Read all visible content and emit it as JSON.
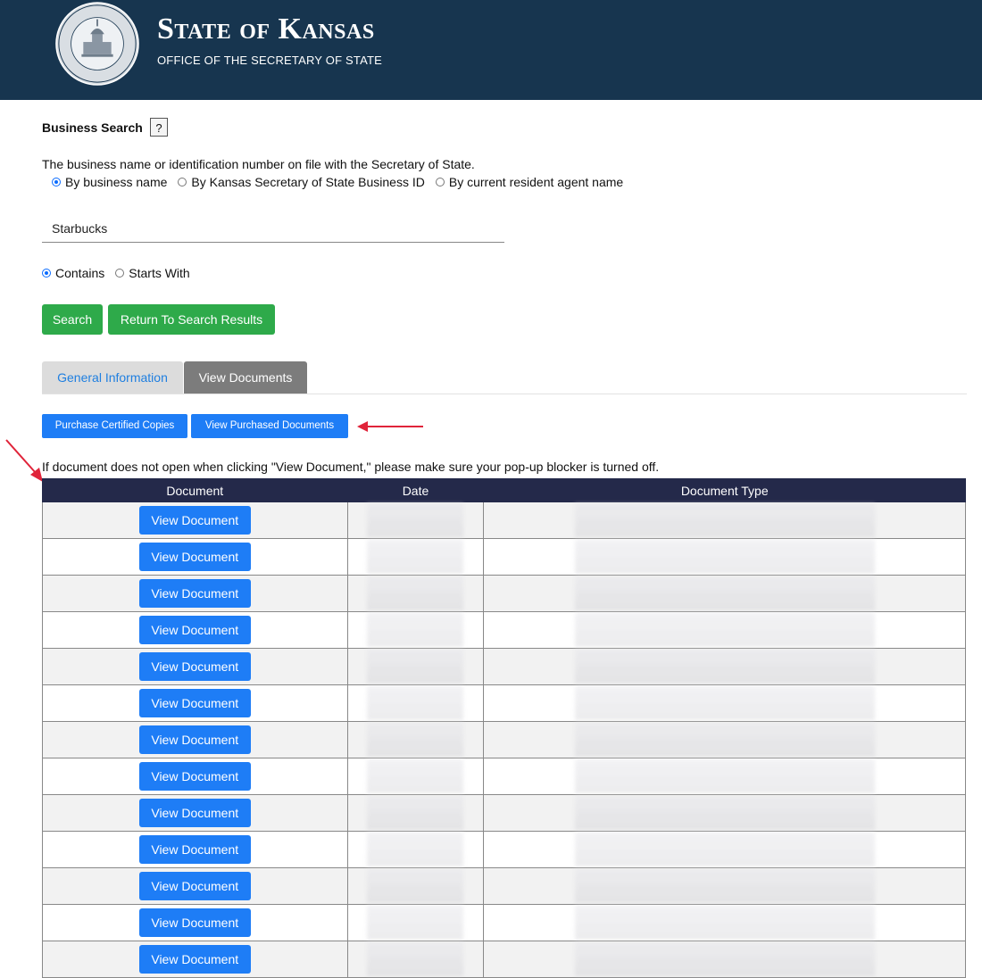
{
  "header": {
    "title": "State of Kansas",
    "subtitle": "OFFICE OF THE SECRETARY OF STATE",
    "seal_text_top": "SECRETARY OF STATE",
    "seal_text_bottom": "STATE OF KANSAS"
  },
  "search": {
    "label": "Business Search",
    "help": "?",
    "description": "The business name or identification number on file with the Secretary of State.",
    "mode_options": [
      {
        "label": "By business name",
        "selected": true
      },
      {
        "label": "By Kansas Secretary of State Business ID",
        "selected": false
      },
      {
        "label": "By current resident agent name",
        "selected": false
      }
    ],
    "query": "Starbucks",
    "match_options": [
      {
        "label": "Contains",
        "selected": true
      },
      {
        "label": "Starts With",
        "selected": false
      }
    ],
    "search_button": "Search",
    "return_button": "Return To Search Results"
  },
  "tabs": {
    "general": "General Information",
    "documents": "View Documents"
  },
  "actions": {
    "purchase": "Purchase Certified Copies",
    "view_purchased": "View Purchased Documents"
  },
  "notice": "If document does not open when clicking \"View Document,\" please make sure your pop-up blocker is turned off.",
  "table": {
    "headers": [
      "Document",
      "Date",
      "Document Type"
    ],
    "button_label": "View Document",
    "rows": [
      {
        "date": "",
        "type": ""
      },
      {
        "date": "",
        "type": ""
      },
      {
        "date": "",
        "type": ""
      },
      {
        "date": "",
        "type": ""
      },
      {
        "date": "",
        "type": ""
      },
      {
        "date": "",
        "type": ""
      },
      {
        "date": "",
        "type": ""
      },
      {
        "date": "",
        "type": ""
      },
      {
        "date": "",
        "type": ""
      },
      {
        "date": "",
        "type": ""
      },
      {
        "date": "",
        "type": ""
      },
      {
        "date": "",
        "type": ""
      },
      {
        "date": "",
        "type": ""
      }
    ]
  },
  "colors": {
    "header_bg": "#17354f",
    "green": "#2eaa4a",
    "blue": "#1e7df6",
    "table_header": "#24294a",
    "arrow": "#e0243a"
  }
}
